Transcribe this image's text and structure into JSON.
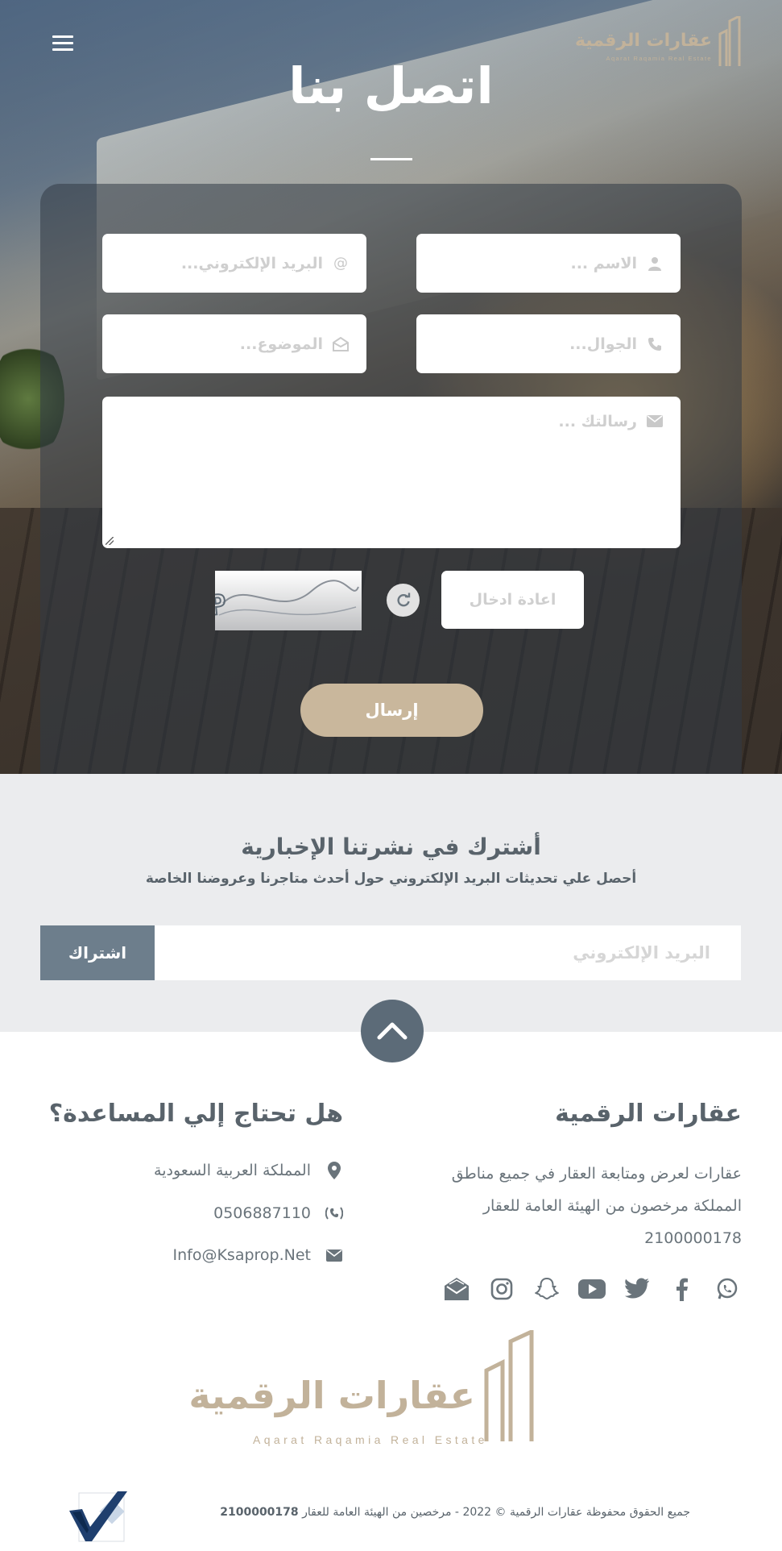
{
  "header": {
    "brand_name": "عقارات الرقمية",
    "brand_tagline": "Aqarat Raqamia Real Estate",
    "page_title": "اتصل بنا"
  },
  "contact_form": {
    "name_placeholder": "الاسم ...",
    "email_placeholder": "البريد الإلكتروني...",
    "phone_placeholder": "الجوال...",
    "subject_placeholder": "الموضوع...",
    "message_placeholder": "رسالتك ...",
    "captcha_placeholder": "اعادة ادخال",
    "captcha_text": "OR7TP",
    "submit_label": "إرسال"
  },
  "newsletter": {
    "title": "أشترك في نشرتنا الإخبارية",
    "subtitle": "أحصل علي تحديثات البريد الإلكتروني حول أحدث متاجرنا وعروضنا الخاصة",
    "email_placeholder": "البريد الإلكتروني",
    "subscribe_label": "اشتراك"
  },
  "footer": {
    "about_title": "عقارات الرقمية",
    "about_text": "عقارات لعرض ومتابعة العقار في جميع مناطق المملكة مرخصون من الهيئة العامة للعقار 2100000178",
    "help_title": "هل تحتاج إلي المساعدة؟",
    "location": "المملكة العربية السعودية",
    "phone": "0506887110",
    "email": "Info@Ksaprop.Net",
    "social": [
      "whatsapp-icon",
      "facebook-icon",
      "twitter-icon",
      "youtube-icon",
      "snapchat-icon",
      "instagram-icon",
      "email-open-icon"
    ],
    "logo_name": "عقارات الرقمية",
    "logo_tagline": "Aqarat Raqamia Real Estate",
    "copyright_text": "جميع الحقوق محفوظة عقارات الرقمية © 2022 - مرخصين من الهيئة العامة للعقار",
    "license_number": "2100000178"
  },
  "colors": {
    "brand_gold": "#c2b29a",
    "submit_button": "#c9b79c",
    "subscribe_button": "#6d7e8c",
    "text_slate": "#59636b",
    "newsletter_bg": "#ebecee"
  }
}
